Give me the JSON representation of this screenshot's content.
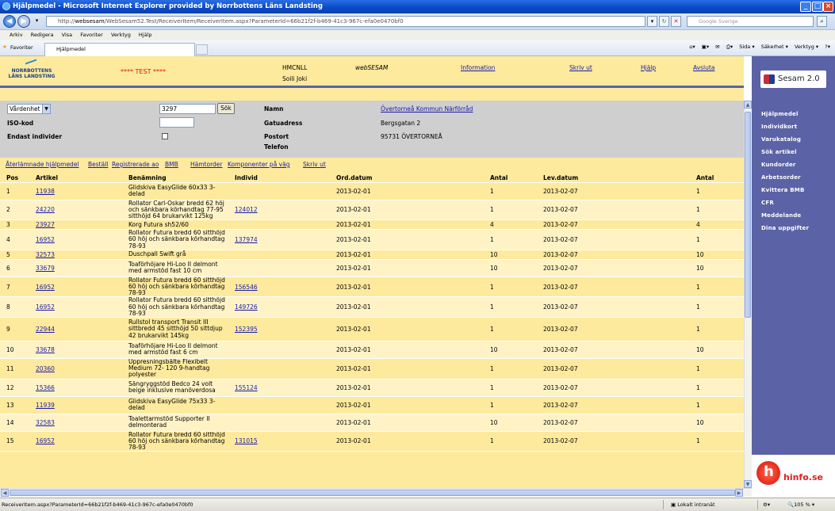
{
  "window": {
    "title": "Hjälpmedel - Microsoft Internet Explorer provided by Norrbottens Läns Landsting"
  },
  "addressbar": {
    "url_prefix": "http://",
    "url_host": "websesam",
    "url_path": "/WebSesam52.Test/ReceiverItem/ReceiverItem.aspx?ParameterId=66b21f2f-b469-41c3-967c-efa0e0470bf0",
    "search_placeholder": "Google Sverige"
  },
  "menu": [
    "Arkiv",
    "Redigera",
    "Visa",
    "Favoriter",
    "Verktyg",
    "Hjälp"
  ],
  "favorites": {
    "label": "Favoriter",
    "tab_title": "Hjälpmedel",
    "commands": [
      "Sida ▾",
      "Säkerhet ▾",
      "Verktyg ▾"
    ]
  },
  "header": {
    "logo_line1": "NORRBOTTENS",
    "logo_line2": "LÄNS LANDSTING",
    "test": "**** TEST ****",
    "org": "HMCNLL",
    "user": "Soili Joki",
    "app": "webSESAM",
    "links": [
      "Information",
      "Skriv ut",
      "Hjälp",
      "Avsluta"
    ]
  },
  "form": {
    "select_value": "Vårdenhet",
    "id_value": "3297",
    "search_button": "Sök",
    "iso_label": "ISO-kod",
    "only_individuals_label": "Endast individer",
    "namn_label": "Namn",
    "namn_value": "Övertorneå Kommun Närförråd",
    "gatuadress_label": "Gatuadress",
    "gatuadress_value": "Bergsgatan 2",
    "postort_label": "Postort",
    "postort_value": "95731 ÖVERTORNEÅ",
    "telefon_label": "Telefon"
  },
  "actions": [
    "Återlämnade hjälpmedel",
    "Beställ",
    "Registrerade ao",
    "BMB",
    "Hämtorder",
    "Komponenter på väg",
    "Skriv ut"
  ],
  "table": {
    "columns": [
      "Pos",
      "Artikel",
      "Benämning",
      "Individ",
      "Ord.datum",
      "Antal",
      "Lev.datum",
      "Antal"
    ],
    "rows": [
      {
        "pos": "1",
        "artikel": "11938",
        "benamning": "Glidskiva EasyGlide 60x33 3-delad",
        "individ": "",
        "orddatum": "2013-02-01",
        "antal": "1",
        "levdatum": "2013-02-07",
        "antal2": "1"
      },
      {
        "pos": "2",
        "artikel": "24220",
        "benamning": "Rollator Carl-Oskar bredd 62 höj och sänkbara körhandtag 77-95 sitthöjd 64 brukarvikt 125kg",
        "individ": "124012",
        "orddatum": "2013-02-01",
        "antal": "1",
        "levdatum": "2013-02-07",
        "antal2": "1"
      },
      {
        "pos": "3",
        "artikel": "23927",
        "benamning": "Korg Futura sh52/60",
        "individ": "",
        "orddatum": "2013-02-01",
        "antal": "4",
        "levdatum": "2013-02-07",
        "antal2": "4"
      },
      {
        "pos": "4",
        "artikel": "16952",
        "benamning": "Rollator Futura bredd 60 sitthöjd 60 höj och sänkbara körhandtag 78-93",
        "individ": "137974",
        "orddatum": "2013-02-01",
        "antal": "1",
        "levdatum": "2013-02-07",
        "antal2": "1"
      },
      {
        "pos": "5",
        "artikel": "32573",
        "benamning": "Duschpall Swift grå",
        "individ": "",
        "orddatum": "2013-02-01",
        "antal": "10",
        "levdatum": "2013-02-07",
        "antal2": "10"
      },
      {
        "pos": "6",
        "artikel": "33679",
        "benamning": "Toaförhöjare Hi-Loo II delmont med armstöd fast 10 cm",
        "individ": "",
        "orddatum": "2013-02-01",
        "antal": "10",
        "levdatum": "2013-02-07",
        "antal2": "10"
      },
      {
        "pos": "7",
        "artikel": "16952",
        "benamning": "Rollator Futura bredd 60 sitthöjd 60 höj och sänkbara körhandtag 78-93",
        "individ": "156546",
        "orddatum": "2013-02-01",
        "antal": "1",
        "levdatum": "2013-02-07",
        "antal2": "1"
      },
      {
        "pos": "8",
        "artikel": "16952",
        "benamning": "Rollator Futura bredd 60 sitthöjd 60 höj och sänkbara körhandtag 78-93",
        "individ": "149726",
        "orddatum": "2013-02-01",
        "antal": "1",
        "levdatum": "2013-02-07",
        "antal2": "1"
      },
      {
        "pos": "9",
        "artikel": "22944",
        "benamning": "Rullstol transport Transit III sittbredd 45 sitthöjd 50 sittdjup 42 brukarvikt 145kg",
        "individ": "152395",
        "orddatum": "2013-02-01",
        "antal": "1",
        "levdatum": "2013-02-07",
        "antal2": "1"
      },
      {
        "pos": "10",
        "artikel": "33678",
        "benamning": "Toaförhöjare Hi-Loo II delmont med armstöd fast 6 cm",
        "individ": "",
        "orddatum": "2013-02-01",
        "antal": "10",
        "levdatum": "2013-02-07",
        "antal2": "10"
      },
      {
        "pos": "11",
        "artikel": "20360",
        "benamning": "Uppresningsbälte Flexibelt Medium 72- 120 9-handtag polyester",
        "individ": "",
        "orddatum": "2013-02-01",
        "antal": "1",
        "levdatum": "2013-02-07",
        "antal2": "1"
      },
      {
        "pos": "12",
        "artikel": "15366",
        "benamning": "Sängryggstöd Bedco 24 volt beige inklusive manöverdosa",
        "individ": "155124",
        "orddatum": "2013-02-01",
        "antal": "1",
        "levdatum": "2013-02-07",
        "antal2": "1"
      },
      {
        "pos": "13",
        "artikel": "11939",
        "benamning": "Glidskiva EasyGlide 75x33 3-delad",
        "individ": "",
        "orddatum": "2013-02-01",
        "antal": "1",
        "levdatum": "2013-02-07",
        "antal2": "1"
      },
      {
        "pos": "14",
        "artikel": "32583",
        "benamning": "Toalettarmstöd Supporter II delmonterad",
        "individ": "",
        "orddatum": "2013-02-01",
        "antal": "10",
        "levdatum": "2013-02-07",
        "antal2": "10"
      },
      {
        "pos": "15",
        "artikel": "16952",
        "benamning": "Rollator Futura bredd 60 sitthöjd 60 höj och sänkbara körhandtag 78-93",
        "individ": "131015",
        "orddatum": "2013-02-01",
        "antal": "1",
        "levdatum": "2013-02-07",
        "antal2": "1"
      }
    ]
  },
  "sidebar": {
    "brand": "Sesam 2.0",
    "items": [
      "Hjälpmedel",
      "Individkort",
      "Varukatalog",
      "Sök artikel",
      "Kundorder",
      "Arbetsorder",
      "Kvittera BMB",
      "CFR",
      "Meddelande",
      "Dina uppgifter"
    ],
    "footer_logo": "hinfo.se"
  },
  "statusbar": {
    "text": "ReceiverItem.aspx?ParameterId=66b21f2f-b469-41c3-967c-efa0e0470bf0",
    "zone": "Lokalt intranät",
    "zoom": "105 %"
  },
  "colors": {
    "page_bg": "#fdea9d",
    "sidebar": "#5b62a6",
    "link": "#1a1aaa",
    "form_bg": "#cfcfcf",
    "test_red": "#e01010"
  }
}
